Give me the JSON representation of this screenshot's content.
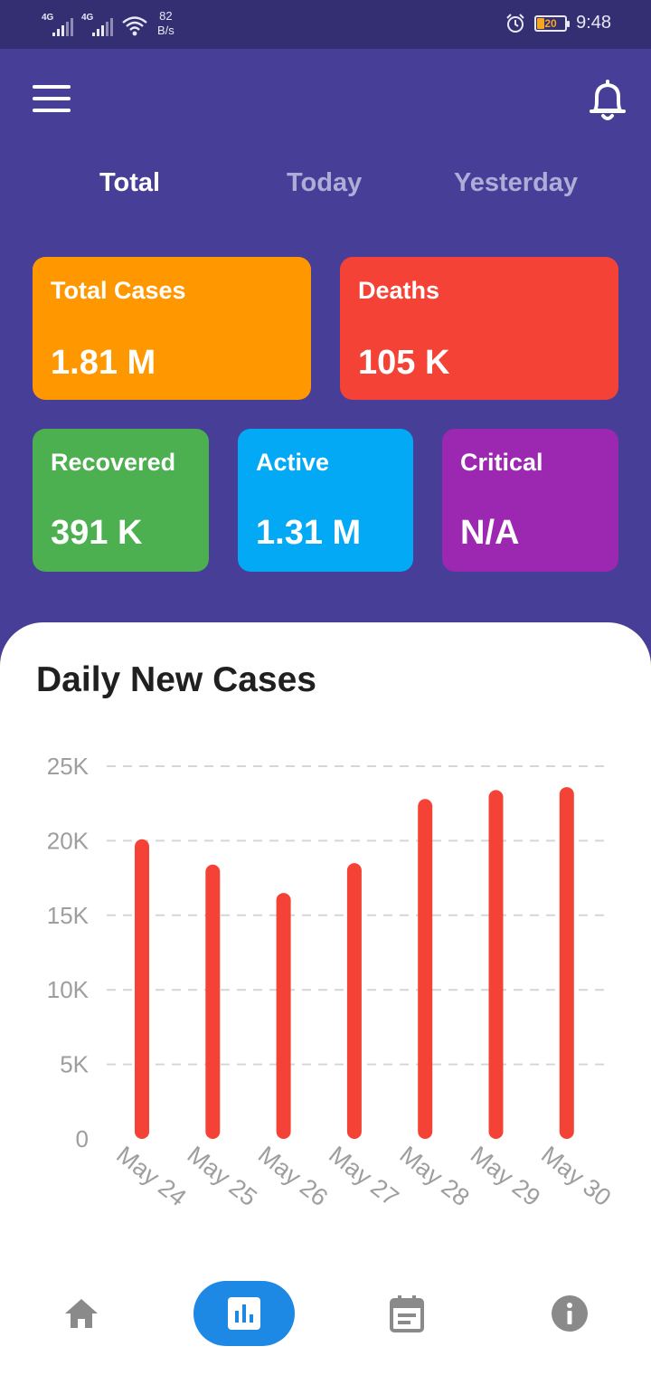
{
  "status_bar": {
    "network_1": "4G",
    "network_2": "4G",
    "speed_value": "82",
    "speed_unit": "B/s",
    "battery_level": "20",
    "time": "9:48"
  },
  "header": {
    "menu_icon": "hamburger-menu-icon",
    "notification_icon": "bell-icon"
  },
  "tabs": [
    {
      "label": "Total",
      "active": true
    },
    {
      "label": "Today",
      "active": false
    },
    {
      "label": "Yesterday",
      "active": false
    }
  ],
  "cards": {
    "total_cases": {
      "label": "Total Cases",
      "value": "1.81 M",
      "color": "#ff9800"
    },
    "deaths": {
      "label": "Deaths",
      "value": "105 K",
      "color": "#f44336"
    },
    "recovered": {
      "label": "Recovered",
      "value": "391 K",
      "color": "#4caf50"
    },
    "active": {
      "label": "Active",
      "value": "1.31 M",
      "color": "#03a9f4"
    },
    "critical": {
      "label": "Critical",
      "value": "N/A",
      "color": "#9c27b0"
    }
  },
  "chart_section": {
    "title": "Daily New Cases"
  },
  "chart_data": {
    "type": "bar",
    "title": "Daily New Cases",
    "categories": [
      "May 24",
      "May 25",
      "May 26",
      "May 27",
      "May 28",
      "May 29",
      "May 30"
    ],
    "values": [
      20100,
      18400,
      16500,
      18500,
      22800,
      23400,
      23600
    ],
    "ylim": [
      0,
      25000
    ],
    "y_ticks": [
      "0",
      "5K",
      "10K",
      "15K",
      "20K",
      "25K"
    ],
    "y_tick_values": [
      0,
      5000,
      10000,
      15000,
      20000,
      25000
    ],
    "bar_color": "#f44336",
    "grid": true,
    "xlabel": "",
    "ylabel": ""
  },
  "bottom_nav": [
    {
      "icon": "home-icon",
      "active": false
    },
    {
      "icon": "bar-chart-icon",
      "active": true
    },
    {
      "icon": "calendar-icon",
      "active": false
    },
    {
      "icon": "info-icon",
      "active": false
    }
  ],
  "colors": {
    "primary": "#473f97",
    "status_bar": "#342e73",
    "accent": "#1e88e5",
    "tab_inactive": "#b0acd8"
  }
}
